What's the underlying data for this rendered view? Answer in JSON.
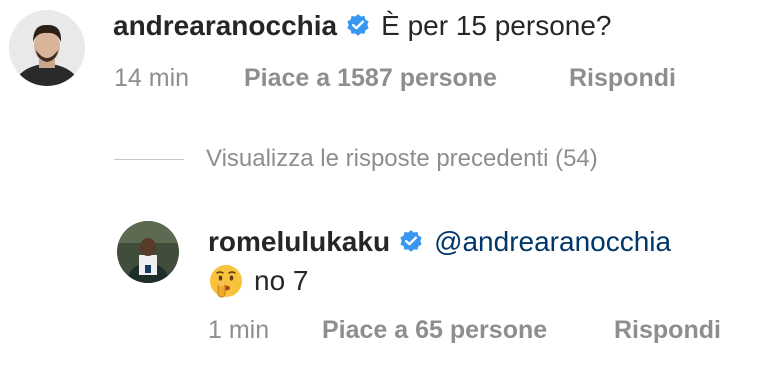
{
  "comments": [
    {
      "username": "andrearanocchia",
      "text": "È per 15 persone?",
      "time": "14 min",
      "likes": "Piace a 1587 persone",
      "reply_label": "Rispondi"
    }
  ],
  "view_replies_label": "Visualizza le risposte precedenti (54)",
  "reply": {
    "username": "romelulukaku",
    "mention": "@andrearanocchia",
    "emoji": "shushing-face-emoji",
    "text": "no 7",
    "time": "1 min",
    "likes": "Piace a 65 persone",
    "reply_label": "Rispondi"
  },
  "colors": {
    "verified": "#3897f0",
    "mention": "#00376b",
    "meta": "#8e8e8e",
    "text": "#262626"
  }
}
